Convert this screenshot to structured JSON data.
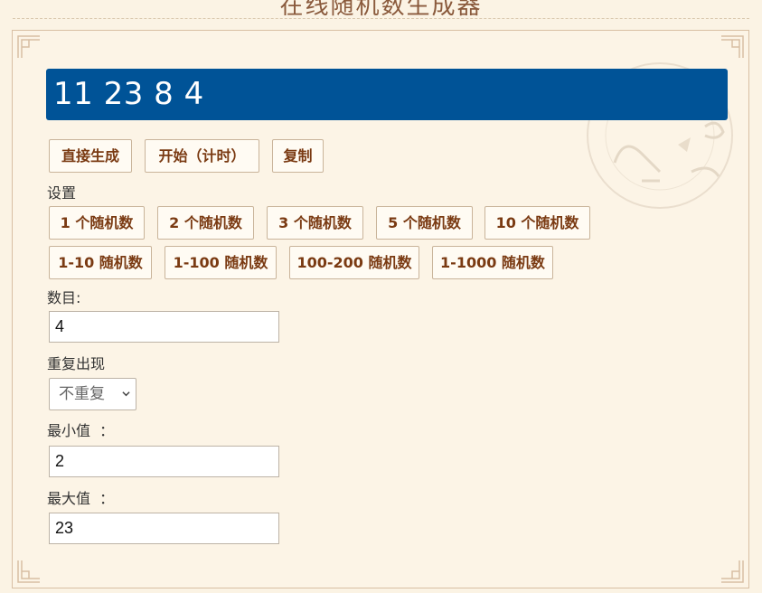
{
  "header": {
    "title": "在线随机数生成器"
  },
  "result": {
    "text": "11 23 8 4"
  },
  "actions": {
    "generate": "直接生成",
    "start_timed": "开始（计时）",
    "copy": "复制"
  },
  "settings": {
    "heading": "设置",
    "count_presets": [
      "1 个随机数",
      "2 个随机数",
      "3 个随机数",
      "5 个随机数",
      "10 个随机数"
    ],
    "range_presets": [
      "1-10 随机数",
      "1-100 随机数",
      "100-200 随机数",
      "1-1000 随机数"
    ],
    "count": {
      "label": "数目:",
      "value": "4"
    },
    "repeat": {
      "label": "重复出现",
      "selected": "不重复"
    },
    "min": {
      "label": "最小值  ：",
      "value": "2"
    },
    "max": {
      "label": "最大值  ：",
      "value": "23"
    }
  },
  "colors": {
    "result_bg": "#005397",
    "button_text": "#7a3a12",
    "page_bg": "#fbf3e4"
  }
}
